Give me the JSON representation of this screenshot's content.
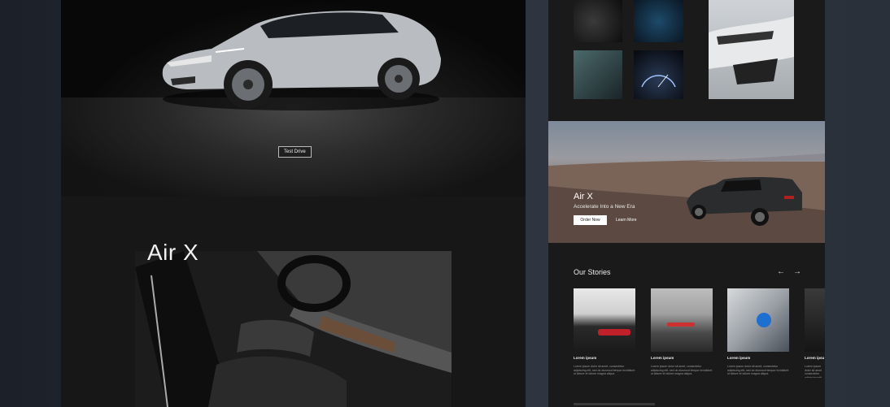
{
  "hero": {
    "cta_label": "Test Drive"
  },
  "interior_section": {
    "title": "Air X"
  },
  "promo": {
    "title": "Air X",
    "subtitle": "Accelerate Into a New Era",
    "primary_button": "Order Now",
    "secondary_link": "Learn More"
  },
  "stories": {
    "title": "Our Stories",
    "prev_icon": "arrow-left-icon",
    "next_icon": "arrow-right-icon",
    "items": [
      {
        "label": "Lorem ipsum",
        "text": "Lorem ipsum dolor sit amet, consectetur adipiscing elit, sed do eiusmod tempor incididunt ut labore et dolore magna aliqua."
      },
      {
        "label": "Lorem ipsum",
        "text": "Lorem ipsum dolor sit amet, consectetur adipiscing elit, sed do eiusmod tempor incididunt ut labore et dolore magna aliqua."
      },
      {
        "label": "Lorem ipsum",
        "text": "Lorem ipsum dolor sit amet, consectetur adipiscing elit, sed do eiusmod tempor incididunt ut labore et dolore magna aliqua."
      },
      {
        "label": "Lorem ipsu",
        "text": "Lorem ipsum dolor sit amet consectetur adipiscing elit"
      }
    ]
  },
  "colors": {
    "background": "#262b33",
    "panel": "#171717",
    "accent_white": "#ffffff"
  }
}
